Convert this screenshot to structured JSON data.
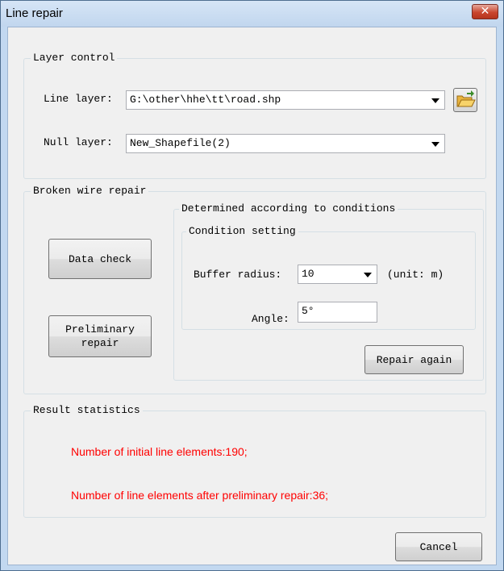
{
  "window": {
    "title": "Line repair"
  },
  "layer_control": {
    "legend": "Layer control",
    "line_layer_label": "Line layer:",
    "line_layer_value": "G:\\other\\hhe\\tt\\road.shp",
    "null_layer_label": "Null layer:",
    "null_layer_value": "New_Shapefile(2)",
    "browse_icon": "open-folder-icon"
  },
  "broken_wire_repair": {
    "legend": "Broken wire repair",
    "data_check_label": "Data check",
    "preliminary_repair_label": "Preliminary\nrepair",
    "conditions": {
      "legend": "Determined according to conditions",
      "setting": {
        "legend": "Condition setting",
        "buffer_radius_label": "Buffer radius:",
        "buffer_radius_value": "10",
        "unit_label": "(unit: m)",
        "angle_label": "Angle:",
        "angle_value": "5°"
      },
      "repair_again_label": "Repair again"
    }
  },
  "result_statistics": {
    "legend": "Result statistics",
    "initial_count_text": "Number of initial line elements:190;",
    "after_repair_text": "Number of line elements after preliminary repair:36;"
  },
  "cancel_label": "Cancel",
  "colors": {
    "stat_text": "#ff0000",
    "title_bar": "#c6daf1",
    "close_button": "#c9462f"
  }
}
